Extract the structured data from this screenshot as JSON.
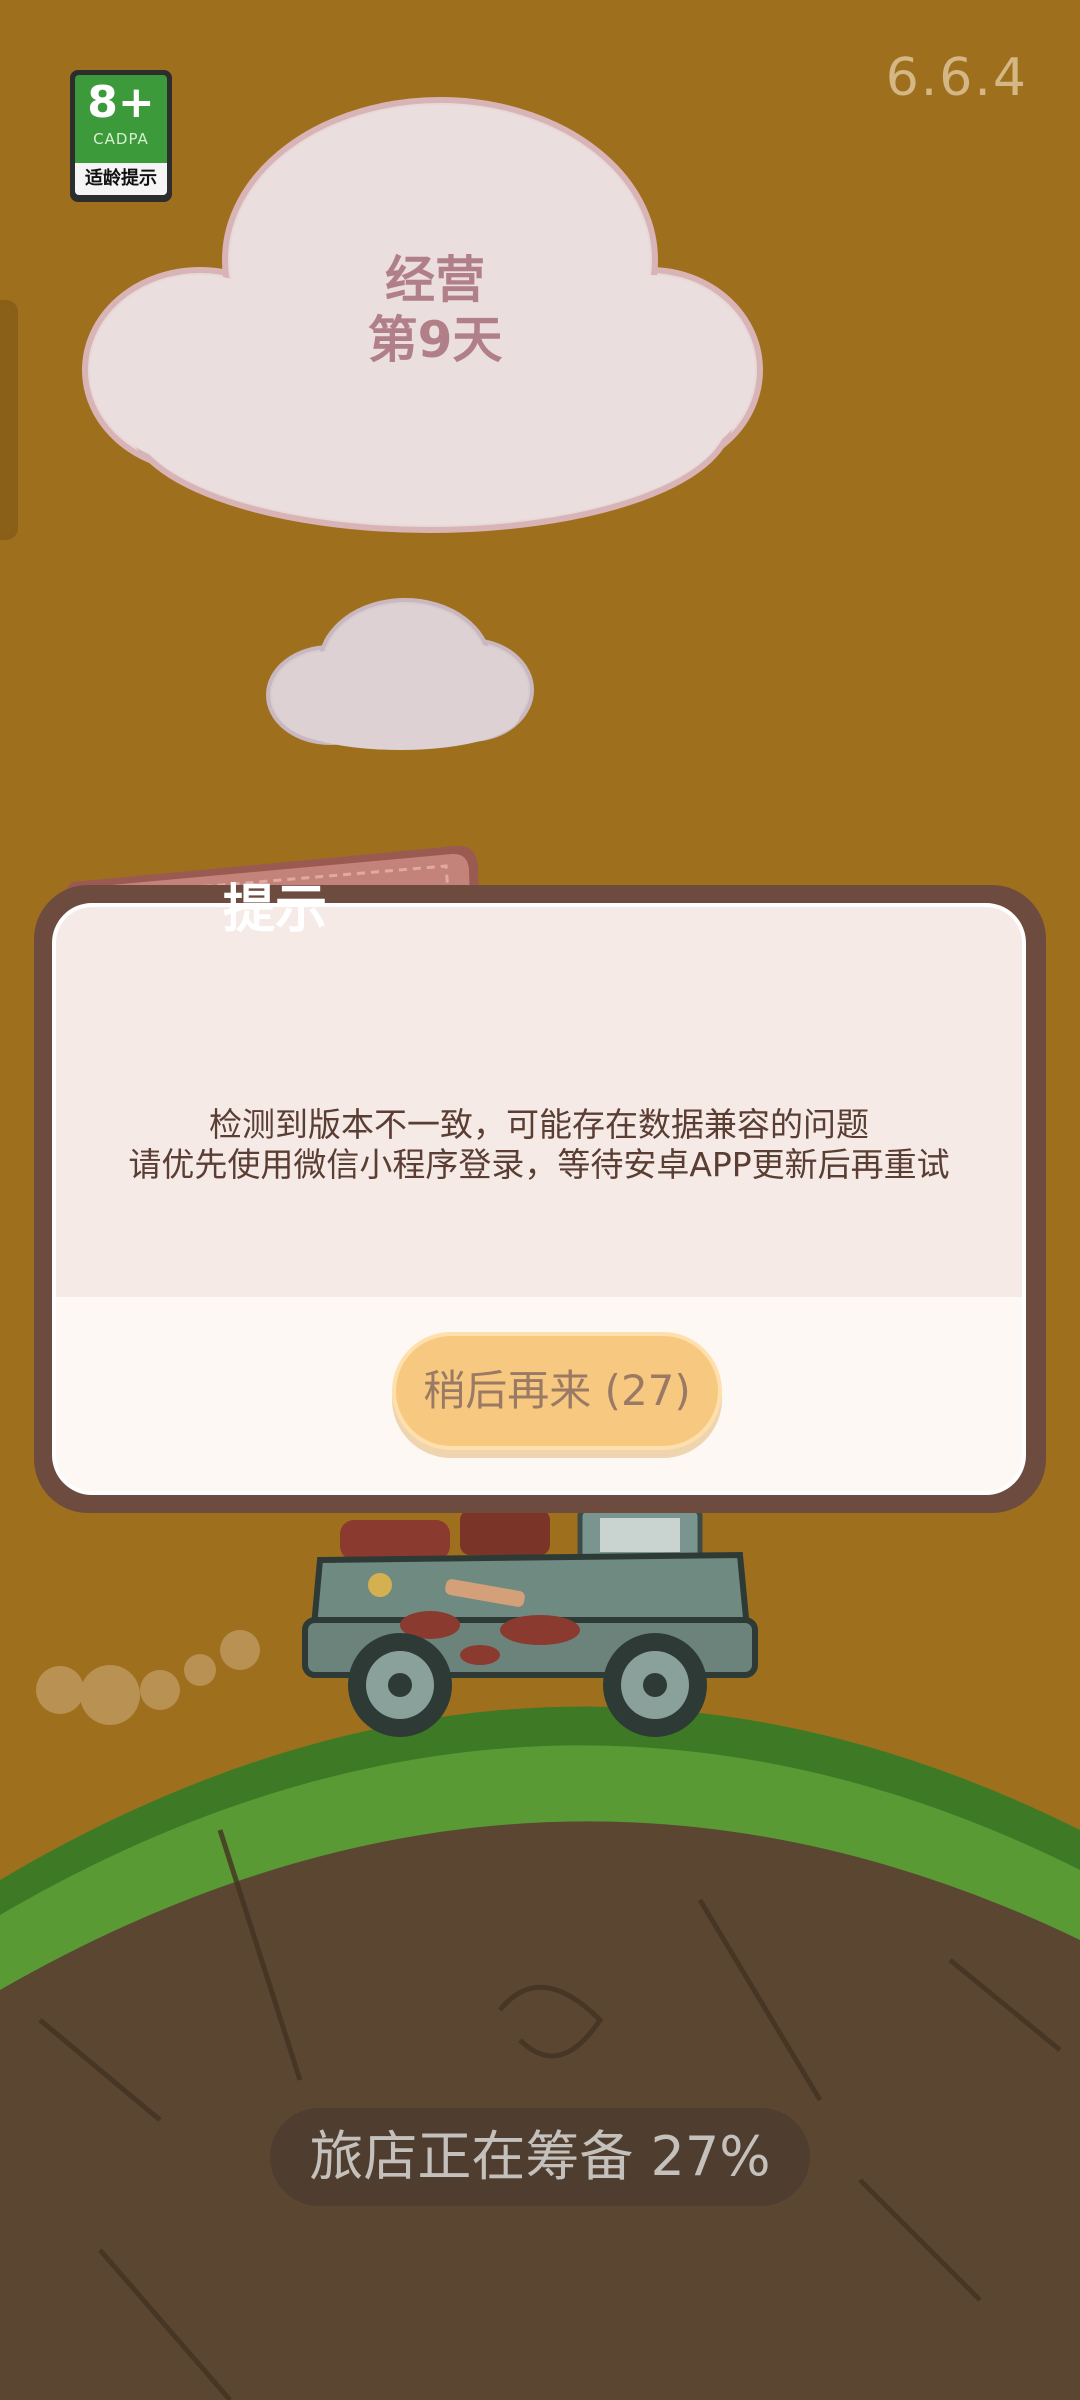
{
  "app": {
    "version": "6.6.4",
    "age_badge": {
      "rating": "8+",
      "org": "CADPA",
      "caption": "适龄提示"
    }
  },
  "cloud": {
    "line1": "经营",
    "line2": "第9天"
  },
  "dialog": {
    "title": "提示",
    "message_line1": "检测到版本不一致，可能存在数据兼容的问题",
    "message_line2": "请优先使用微信小程序登录，等待安卓APP更新后再重试",
    "later_button": "稍后再来 (27)"
  },
  "loading": {
    "text": "旅店正在筹备 27%",
    "progress_percent": 27
  },
  "colors": {
    "background": "#9e701e",
    "dialog_frame": "#6e4b3f",
    "tag": "#c4837a",
    "button": "#f7c880",
    "ground": "#5b4632",
    "grass": "#4b8f2c"
  }
}
